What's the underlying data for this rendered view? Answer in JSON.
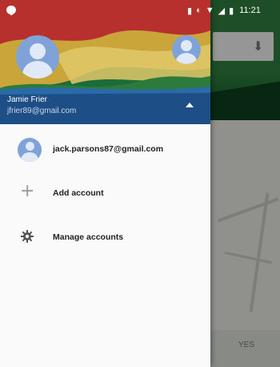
{
  "status_bar": {
    "time": "11:21"
  },
  "header": {
    "account_name": "Jamie Frier",
    "account_email": "jfrier89@gmail.com"
  },
  "accounts": [
    {
      "email": "jack.parsons87@gmail.com",
      "icon": "avatar-icon"
    }
  ],
  "menu": {
    "add_account": {
      "label": "Add account",
      "icon": "plus-icon"
    },
    "manage_accounts": {
      "label": "Manage accounts",
      "icon": "gear-icon"
    }
  },
  "background_app": {
    "bottom_label": "YES"
  },
  "colors": {
    "avatar": "#7fa3d9",
    "drawer_bg": "#fafafa",
    "header_green": "#1a5e34",
    "header_blue": "#1d4f86"
  }
}
